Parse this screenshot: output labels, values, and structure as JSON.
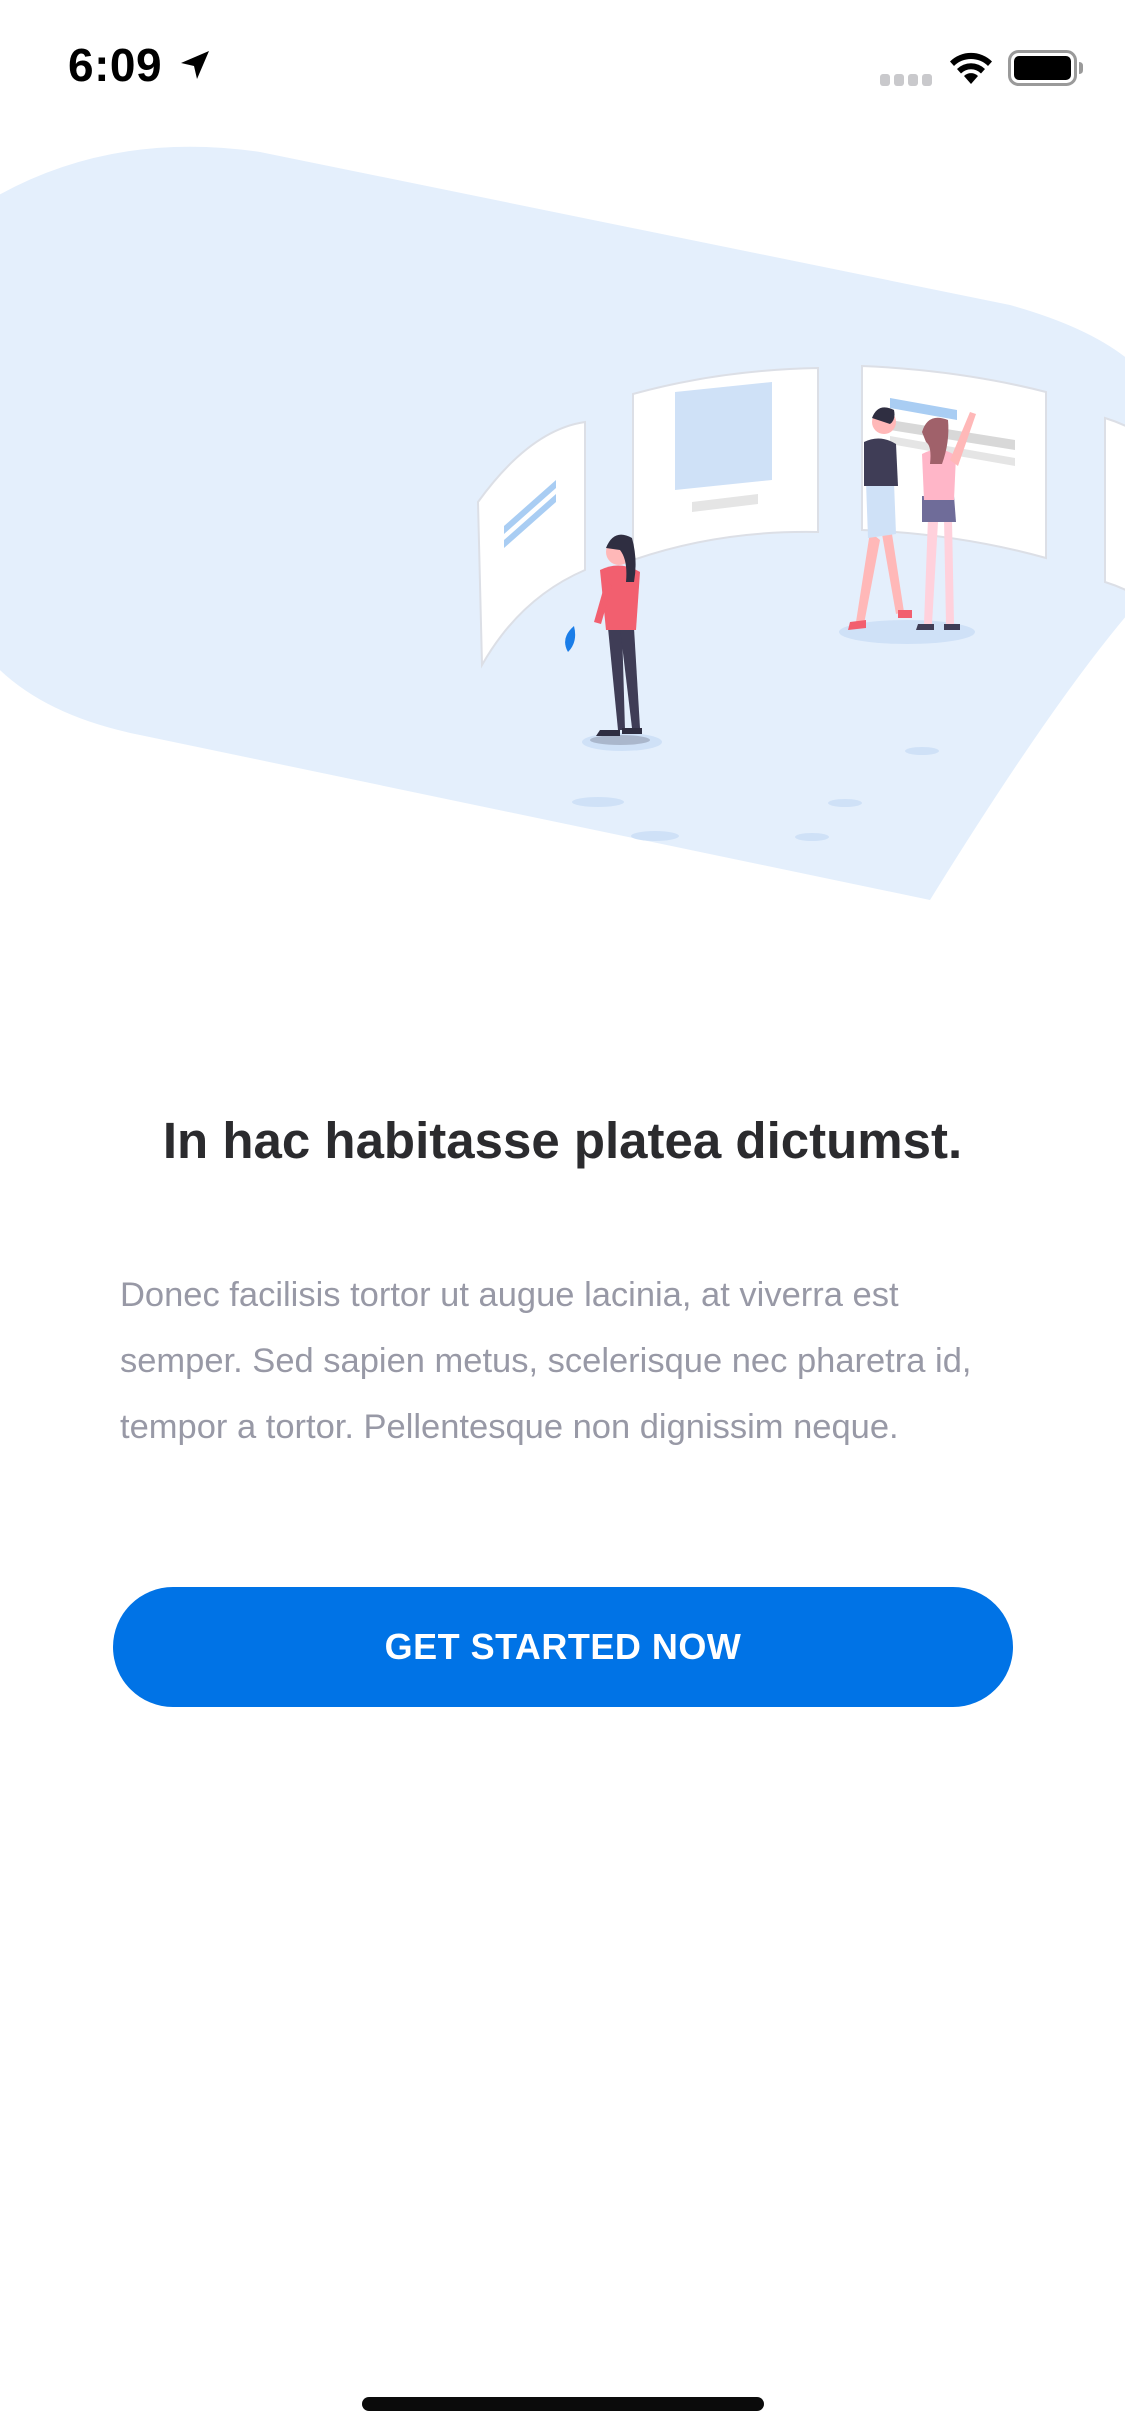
{
  "status_bar": {
    "time": "6:09",
    "icons": [
      "location-arrow-icon",
      "cellular-signal-icon",
      "wifi-icon",
      "battery-icon"
    ]
  },
  "hero": {
    "illustration": "people-viewing-gallery-panels-illustration"
  },
  "content": {
    "headline": "In hac habitasse platea dictumst.",
    "body": "Donec facilisis tortor ut augue lacinia, at viverra est semper. Sed sapien metus, scelerisque nec pharetra id, tempor a tortor. Pellentesque non dignissim neque.",
    "cta_label": "GET STARTED NOW"
  },
  "colors": {
    "accent": "#0073e6",
    "hero_background": "#e4effc",
    "headline": "#2b2b2e",
    "body_text": "#9899a6"
  }
}
